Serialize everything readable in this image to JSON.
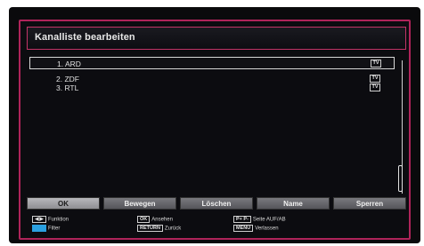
{
  "dialog": {
    "title": "Kanalliste bearbeiten"
  },
  "channels": [
    {
      "label": "1. ARD",
      "type_icon": "TV",
      "selected": true
    },
    {
      "label": "2. ZDF",
      "type_icon": "TV",
      "selected": false
    },
    {
      "label": "3. RTL",
      "type_icon": "TV",
      "selected": false
    }
  ],
  "buttons": [
    {
      "label": "OK",
      "active": true
    },
    {
      "label": "Bewegen",
      "active": false
    },
    {
      "label": "Löschen",
      "active": false
    },
    {
      "label": "Name",
      "active": false
    },
    {
      "label": "Sperren",
      "active": false
    }
  ],
  "legend": {
    "function_key": "◀|▶",
    "function_label": "Funktion",
    "filter_label": "Filter",
    "ok_key": "OK",
    "ok_label": "Ansehen",
    "back_key": "RETURN",
    "back_label": "Zurück",
    "page_key": "P+ P-",
    "page_label": "Seite AUF/AB",
    "menu_key": "MENU",
    "menu_label": "Verlassen"
  },
  "colors": {
    "frame_accent": "#b0245a",
    "filter_key": "#2aa0e0"
  }
}
